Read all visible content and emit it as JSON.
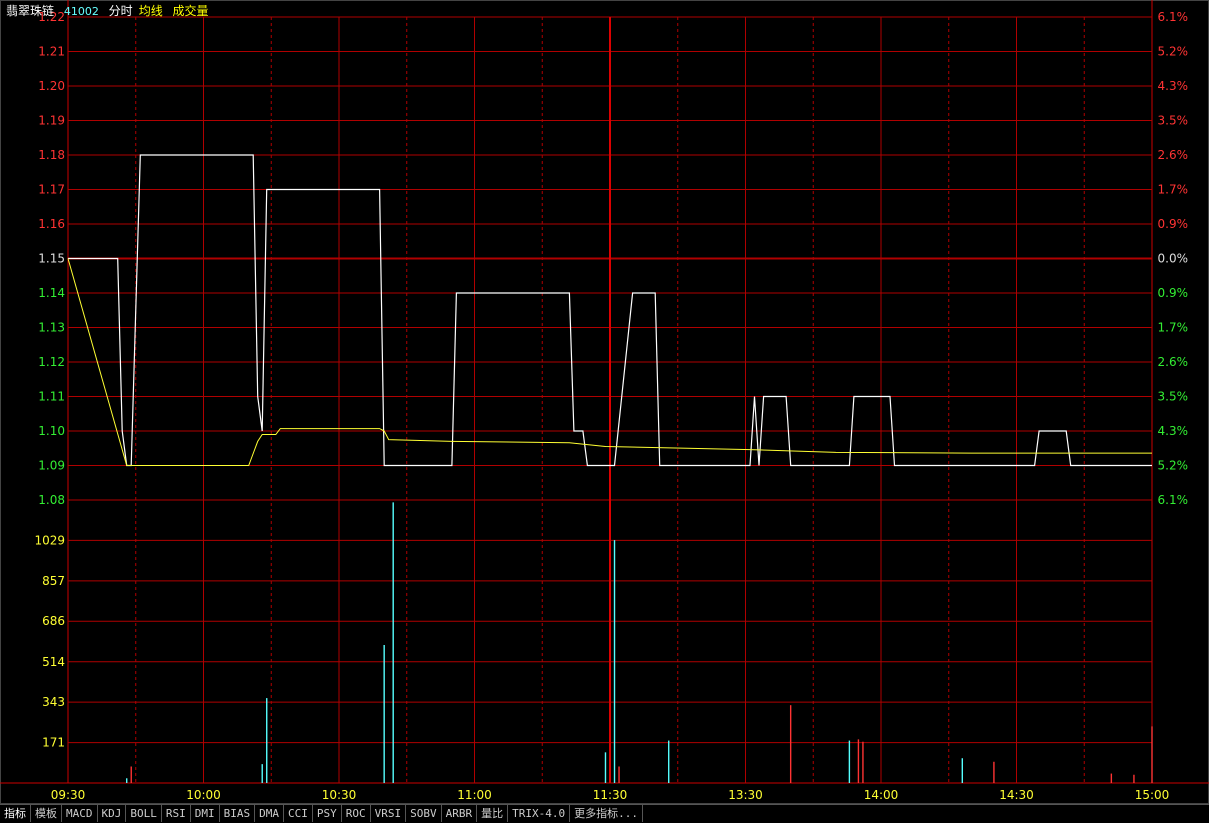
{
  "header": {
    "stock_name": "翡翠珠链",
    "code": "41002",
    "mode": "分时",
    "avg_label": "均线",
    "vol_label": "成交量"
  },
  "chart_data": {
    "type": "line",
    "price_axis": {
      "ticks": [
        "1.22",
        "1.21",
        "1.20",
        "1.19",
        "1.18",
        "1.17",
        "1.16",
        "1.15",
        "1.14",
        "1.13",
        "1.12",
        "1.11",
        "1.10",
        "1.09",
        "1.08"
      ],
      "reference": 1.15,
      "ylim": [
        1.08,
        1.22
      ]
    },
    "pct_axis": {
      "ticks": [
        "6.1%",
        "5.2%",
        "4.3%",
        "3.5%",
        "2.6%",
        "1.7%",
        "0.9%",
        "0.0%",
        "0.9%",
        "1.7%",
        "2.6%",
        "3.5%",
        "4.3%",
        "5.2%",
        "6.1%"
      ]
    },
    "volume_axis": {
      "ticks": [
        "1029",
        "857",
        "686",
        "514",
        "343",
        "171"
      ],
      "ylim": [
        0,
        1200
      ]
    },
    "x_ticks": [
      "09:30",
      "10:00",
      "10:30",
      "11:00",
      "11:30",
      "13:30",
      "14:00",
      "14:30",
      "15:00"
    ],
    "price_series": [
      [
        0,
        1.15
      ],
      [
        11,
        1.15
      ],
      [
        12,
        1.1
      ],
      [
        13,
        1.09
      ],
      [
        14,
        1.09
      ],
      [
        16,
        1.18
      ],
      [
        41,
        1.18
      ],
      [
        42,
        1.11
      ],
      [
        43,
        1.1
      ],
      [
        44,
        1.17
      ],
      [
        69,
        1.17
      ],
      [
        70,
        1.09
      ],
      [
        85,
        1.09
      ],
      [
        86,
        1.14
      ],
      [
        111,
        1.14
      ],
      [
        112,
        1.1
      ],
      [
        114,
        1.1
      ],
      [
        115,
        1.09
      ],
      [
        119,
        1.09
      ],
      [
        121,
        1.09
      ],
      [
        125,
        1.14
      ],
      [
        130,
        1.14
      ],
      [
        131,
        1.09
      ],
      [
        151,
        1.09
      ],
      [
        152,
        1.11
      ],
      [
        153,
        1.09
      ],
      [
        154,
        1.11
      ],
      [
        159,
        1.11
      ],
      [
        160,
        1.09
      ],
      [
        173,
        1.09
      ],
      [
        174,
        1.11
      ],
      [
        182,
        1.11
      ],
      [
        183,
        1.09
      ],
      [
        214,
        1.09
      ],
      [
        215,
        1.1
      ],
      [
        221,
        1.1
      ],
      [
        222,
        1.09
      ],
      [
        240,
        1.09
      ]
    ],
    "avg_series": [
      [
        0,
        1.15
      ],
      [
        13,
        1.09
      ],
      [
        16,
        1.09
      ],
      [
        40,
        1.09
      ],
      [
        42,
        1.097
      ],
      [
        43,
        1.099
      ],
      [
        46,
        1.099
      ],
      [
        47,
        1.1007
      ],
      [
        69,
        1.1007
      ],
      [
        70,
        1.1
      ],
      [
        71,
        1.0975
      ],
      [
        85,
        1.097
      ],
      [
        111,
        1.0966
      ],
      [
        119,
        1.0955
      ],
      [
        151,
        1.0946
      ],
      [
        170,
        1.0938
      ],
      [
        200,
        1.0936
      ],
      [
        240,
        1.0936
      ]
    ],
    "volume_bars": [
      {
        "t": 14,
        "v": 70,
        "color": "#ff3333"
      },
      {
        "t": 13,
        "v": 20,
        "color": "#55ffff"
      },
      {
        "t": 43,
        "v": 80,
        "color": "#55ffff"
      },
      {
        "t": 44,
        "v": 360,
        "color": "#55ffff"
      },
      {
        "t": 70,
        "v": 585,
        "color": "#55ffff"
      },
      {
        "t": 72,
        "v": 1190,
        "color": "#55ffff"
      },
      {
        "t": 119,
        "v": 130,
        "color": "#55ffff"
      },
      {
        "t": 121,
        "v": 1030,
        "color": "#55ffff"
      },
      {
        "t": 122,
        "v": 70,
        "color": "#ff3333"
      },
      {
        "t": 133,
        "v": 180,
        "color": "#55ffff"
      },
      {
        "t": 160,
        "v": 330,
        "color": "#ff3333"
      },
      {
        "t": 173,
        "v": 180,
        "color": "#55ffff"
      },
      {
        "t": 175,
        "v": 185,
        "color": "#ff3333"
      },
      {
        "t": 176,
        "v": 175,
        "color": "#ff3333"
      },
      {
        "t": 198,
        "v": 105,
        "color": "#55ffff"
      },
      {
        "t": 205,
        "v": 90,
        "color": "#ff3333"
      },
      {
        "t": 231,
        "v": 40,
        "color": "#ff3333"
      },
      {
        "t": 236,
        "v": 35,
        "color": "#ff3333"
      },
      {
        "t": 240,
        "v": 240,
        "color": "#ff3333"
      }
    ]
  },
  "tabs": [
    "指标",
    "模板",
    "MACD",
    "KDJ",
    "BOLL",
    "RSI",
    "DMI",
    "BIAS",
    "DMA",
    "CCI",
    "PSY",
    "ROC",
    "VRSI",
    "SOBV",
    "ARBR",
    "量比",
    "TRIX-4.0",
    "更多指标..."
  ]
}
